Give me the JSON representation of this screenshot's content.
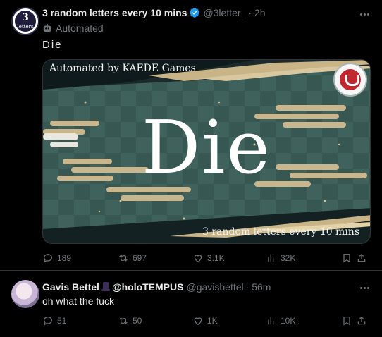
{
  "tweets": [
    {
      "avatar": {
        "number": "3",
        "text": "letters"
      },
      "name": "3 random letters every 10 mins",
      "handle": "@3letter_",
      "time": "· 2h",
      "automated_label": "Automated",
      "text": "Die",
      "media": {
        "caption_top": "Automated by KAEDE Games",
        "big_text": "Die",
        "caption_bottom": "3 random letters every 10 mins"
      },
      "stats": {
        "replies": "189",
        "reposts": "697",
        "likes": "3.1K",
        "views": "32K"
      }
    },
    {
      "name": "Gavis Bettel",
      "name_suffix": "@holoTEMPUS",
      "handle": "@gavisbettel",
      "time": "· 56m",
      "text": "oh what the fuck",
      "stats": {
        "replies": "51",
        "reposts": "50",
        "likes": "1K",
        "views": "10K"
      }
    }
  ],
  "colors": {
    "background": "#000000",
    "text": "#e7e9ea",
    "muted": "#71767b",
    "verified": "#1d9bf0",
    "divider": "#2f3336"
  }
}
